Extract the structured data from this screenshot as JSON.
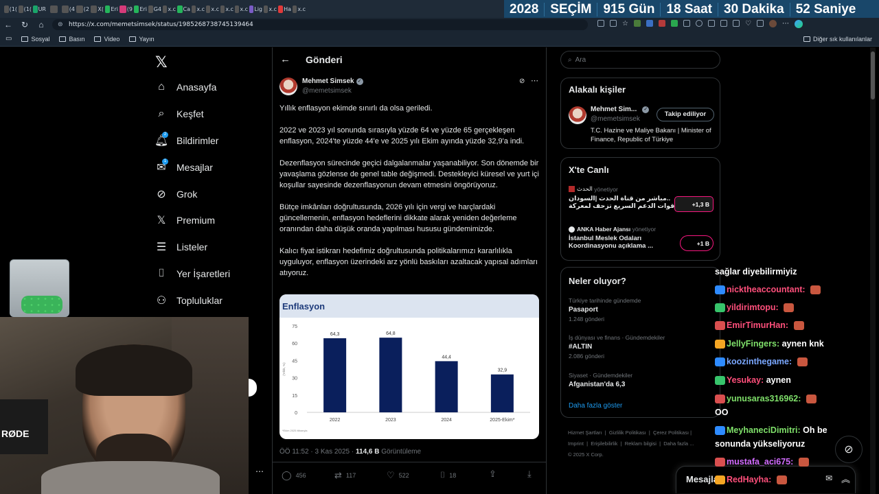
{
  "browser": {
    "tabs": [
      "(1(",
      "(1(",
      "UR",
      "",
      "(4",
      "(2",
      "X(",
      "Eri",
      "(9",
      "Eri",
      "G4",
      "x.c",
      "Ca",
      "x.c",
      "x.c",
      "x.c",
      "x.c",
      "Lig",
      "x.c",
      "Ha",
      "x.c"
    ],
    "countdown": [
      "2028",
      "SEÇİM",
      "915 Gün",
      "18 Saat",
      "30 Dakika",
      "52 Saniye"
    ],
    "url": "https://x.com/memetsimsek/status/1985268738745139464",
    "bookmarks": [
      "Sosyal",
      "Basın",
      "Video",
      "Yayın"
    ],
    "bookmarks_right": "Diğer sık kullanılanlar"
  },
  "nav": {
    "items": [
      {
        "label": "Anasayfa",
        "icon": "home-icon"
      },
      {
        "label": "Keşfet",
        "icon": "search-icon"
      },
      {
        "label": "Bildirimler",
        "icon": "bell-icon",
        "badge": "2"
      },
      {
        "label": "Mesajlar",
        "icon": "mail-icon",
        "badge": "1"
      },
      {
        "label": "Grok",
        "icon": "grok-icon"
      },
      {
        "label": "Premium",
        "icon": "x-logo-icon"
      },
      {
        "label": "Listeler",
        "icon": "list-icon"
      },
      {
        "label": "Yer İşaretleri",
        "icon": "bookmark-icon"
      },
      {
        "label": "Topluluklar",
        "icon": "people-icon"
      }
    ]
  },
  "post": {
    "header_title": "Gönderi",
    "author_name": "Mehmet Simsek",
    "author_handle": "@memetsimsek",
    "paragraphs": [
      "Yıllık enflasyon ekimde sınırlı da olsa geriledi.",
      "2022 ve 2023 yıl sonunda sırasıyla yüzde 64 ve yüzde 65 gerçekleşen enflasyon, 2024'te yüzde 44'e ve 2025 yılı Ekim ayında yüzde 32,9'a indi.",
      "Dezenflasyon sürecinde geçici dalgalanmalar yaşanabiliyor. Son dönemde bir yavaşlama gözlense de genel table değişmedi. Destekleyici küresel ve yurt içi koşullar sayesinde dezenflasyonun devam etmesini öngörüyoruz.",
      "Bütçe imkânları doğrultusunda, 2026 yılı için vergi ve harçlardaki güncellemenin, enflasyon hedeflerini dikkate alarak yeniden değerleme oranından daha düşük oranda yapılması hususu gündemimizde.",
      "Kalıcı fiyat istikrarı hedefimiz doğrultusunda politikalarımızı kararlılıkla uyguluyor, enflasyon üzerindeki arz yönlü baskıları azaltacak yapısal adımları atıyoruz."
    ],
    "meta_time": "ÖÖ 11:52 · 3 Kas 2025 ·",
    "meta_views": "114,6 B",
    "meta_views_label": "Görüntüleme",
    "actions": {
      "replies": "456",
      "reposts": "117",
      "likes": "522",
      "bookmarks": "18"
    }
  },
  "chart_data": {
    "type": "bar",
    "title": "Enflasyon",
    "categories": [
      "2022",
      "2023",
      "2024",
      "2025-Ekim*"
    ],
    "values": [
      64.3,
      64.8,
      44.4,
      32.9
    ],
    "value_labels": [
      "64,3",
      "64,8",
      "44,4",
      "32,9"
    ],
    "ylabel": "(Yıllık, %)",
    "yticks": [
      0,
      15,
      30,
      45,
      60,
      75
    ],
    "ylim": [
      0,
      75
    ],
    "bar_color": "#0a1f5c",
    "source_note": "*Ekim 2025 itibarıyla"
  },
  "right": {
    "search_placeholder": "Ara",
    "related_title": "Alakalı kişiler",
    "related_name": "Mehmet Sim...",
    "related_handle": "@memetsimsek",
    "related_bio": "T.C. Hazine ve Maliye Bakanı | Minister of Finance, Republic of Türkiye",
    "follow_label": "Takip ediliyor",
    "live_title": "X'te Canlı",
    "live": [
      {
        "source": "الحدث",
        "role": "yönetiyor",
        "text1": "مباشر من قناة الحدث |السودان..",
        "text2": "قوات الدعم السريع تزحف لمعركة ...",
        "count": "+1,3 B"
      },
      {
        "source": "ANKA Haber Ajansı",
        "role": "yönetiyor",
        "text1": "İstanbul Meslek Odaları",
        "text2": "Koordinasyonu açıklama ...",
        "count": "+1 B"
      }
    ],
    "trends_title": "Neler oluyor?",
    "trends": [
      {
        "cat": "Türkiye tarihinde gündemde",
        "name": "Pasaport",
        "count": "1.248 gönderi"
      },
      {
        "cat": "İş dünyası ve finans · Gündemdekiler",
        "name": "#ALTIN",
        "count": "2.086 gönderi"
      },
      {
        "cat": "Siyaset · Gündemdekiler",
        "name": "Afganistan'da 6,3",
        "count": ""
      }
    ],
    "show_more": "Daha fazla göster",
    "footer_links": [
      "Hizmet Şartları",
      "Gizlilik Politikası",
      "Çerez Politikası",
      "Imprint",
      "Erişilebilirlik",
      "Reklam bilgisi",
      "Daha fazla ..."
    ],
    "copyright": "© 2025 X Corp.",
    "messages_label": "Mesajlar"
  },
  "chat": [
    {
      "user": "",
      "text": "sağlar diyebilirmiyiz",
      "color": "#ffffff"
    },
    {
      "user": "nicktheaccountant:",
      "text": "",
      "color": "#ff4f7b"
    },
    {
      "user": "yildirimtopu:",
      "text": "",
      "color": "#ff4f7b"
    },
    {
      "user": "EmirTimurHan:",
      "text": "",
      "color": "#ff4f7b"
    },
    {
      "user": "JellyFingers:",
      "text": "aynen knk",
      "color": "#7fe06a"
    },
    {
      "user": "koozinthegame:",
      "text": "",
      "color": "#7aa7ff"
    },
    {
      "user": "Yesukay:",
      "text": "aynen",
      "color": "#ff4f7b"
    },
    {
      "user": "yunusaras316962:",
      "text": "",
      "color": "#7fe06a"
    },
    {
      "user": "",
      "text": "OO",
      "color": "#ffffff"
    },
    {
      "user": "MeyhaneciDimitri:",
      "text": "Oh be",
      "color": "#7fe06a"
    },
    {
      "user": "",
      "text": "sonunda yükseliyoruz",
      "color": "#ffffff"
    },
    {
      "user": "mustafa_aci675:",
      "text": "",
      "color": "#d26bff"
    },
    {
      "user": "RedHayha:",
      "text": "",
      "color": "#ff4f7b"
    }
  ],
  "colors": {
    "accent": "#1d9bf0",
    "chrome": "#1f2b38",
    "countdown_bg": "#19476a"
  }
}
